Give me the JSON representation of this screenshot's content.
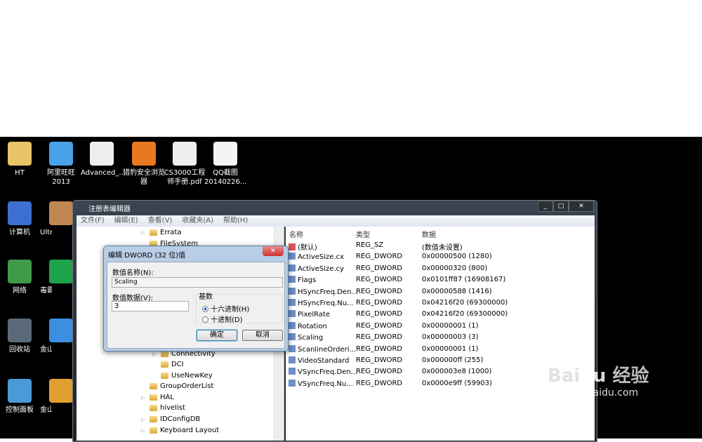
{
  "desktop": {
    "icons": [
      {
        "label": "HT",
        "icon": "user-folder-icon",
        "color": "#e8c467"
      },
      {
        "label": "阿里旺旺 2013",
        "icon": "aliwangwang-icon",
        "color": "#4aa3e8"
      },
      {
        "label": "Advanced_...",
        "icon": "pdf-document-icon",
        "color": "#eeeeee"
      },
      {
        "label": "猎豹安全浏览器",
        "icon": "liebao-browser-icon",
        "color": "#e8791f"
      },
      {
        "label": "CS3000工程师手册.pdf",
        "icon": "pdf-document-icon",
        "color": "#eeeeee"
      },
      {
        "label": "QQ截图 20140226...",
        "icon": "image-file-icon",
        "color": "#f4f4f4"
      },
      {
        "label": "计算机",
        "icon": "computer-icon",
        "color": "#3d6fd0"
      },
      {
        "label": "UltraISO",
        "icon": "ultraiso-disc-icon",
        "color": "#c08850"
      },
      {
        "label": "网络",
        "icon": "network-icon",
        "color": "#3f9a4a"
      },
      {
        "label": "毒霸安全",
        "icon": "duba-icon",
        "color": "#1fa34a"
      },
      {
        "label": "回收站",
        "icon": "recycle-bin-icon",
        "color": "#5a6a78"
      },
      {
        "label": "金山卫士",
        "icon": "jinshan-shield-icon",
        "color": "#3b8fe0"
      },
      {
        "label": "控制面板",
        "icon": "control-panel-icon",
        "color": "#4a9ad8"
      },
      {
        "label": "金山卫士软件管理",
        "icon": "software-manager-icon",
        "color": "#e0a030"
      }
    ]
  },
  "regedit": {
    "title": "注册表编辑器",
    "menu": [
      "文件(F)",
      "编辑(E)",
      "查看(V)",
      "收藏夹(A)",
      "帮助(H)"
    ],
    "tree": [
      "Errata",
      "FileSystem",
      "Connectivity",
      "DCI",
      "UseNewKey",
      "GroupOrderList",
      "HAL",
      "hivelist",
      "IDConfigDB",
      "Keyboard Layout"
    ],
    "columns": [
      "名称",
      "类型",
      "数据"
    ],
    "rows": [
      {
        "name": "(默认)",
        "type": "REG_SZ",
        "data": "(数值未设置)"
      },
      {
        "name": "ActiveSize.cx",
        "type": "REG_DWORD",
        "data": "0x00000500 (1280)"
      },
      {
        "name": "ActiveSize.cy",
        "type": "REG_DWORD",
        "data": "0x00000320 (800)"
      },
      {
        "name": "Flags",
        "type": "REG_DWORD",
        "data": "0x0101ff87 (16908167)"
      },
      {
        "name": "HSyncFreq.Den...",
        "type": "REG_DWORD",
        "data": "0x00000588 (1416)"
      },
      {
        "name": "HSyncFreq.Nu...",
        "type": "REG_DWORD",
        "data": "0x04216f20 (69300000)"
      },
      {
        "name": "PixelRate",
        "type": "REG_DWORD",
        "data": "0x04216f20 (69300000)"
      },
      {
        "name": "Rotation",
        "type": "REG_DWORD",
        "data": "0x00000001 (1)"
      },
      {
        "name": "Scaling",
        "type": "REG_DWORD",
        "data": "0x00000003 (3)"
      },
      {
        "name": "ScanlineOrderi...",
        "type": "REG_DWORD",
        "data": "0x00000001 (1)"
      },
      {
        "name": "VideoStandard",
        "type": "REG_DWORD",
        "data": "0x000000ff (255)"
      },
      {
        "name": "VSyncFreq.Den...",
        "type": "REG_DWORD",
        "data": "0x000003e8 (1000)"
      },
      {
        "name": "VSyncFreq.Nu...",
        "type": "REG_DWORD",
        "data": "0x0000e9ff (59903)"
      }
    ]
  },
  "dialog": {
    "title": "编辑 DWORD (32 位)值",
    "name_label": "数值名称(N):",
    "name_value": "Scaling",
    "data_label": "数值数据(V):",
    "data_value": "3",
    "base_label": "基数",
    "hex_label": "十六进制(H)",
    "dec_label": "十进制(D)",
    "base_selected": "hex",
    "ok": "确定",
    "cancel": "取消"
  },
  "watermark": {
    "text": "Baidu经验",
    "sub": "jingyan.baidu.com"
  }
}
